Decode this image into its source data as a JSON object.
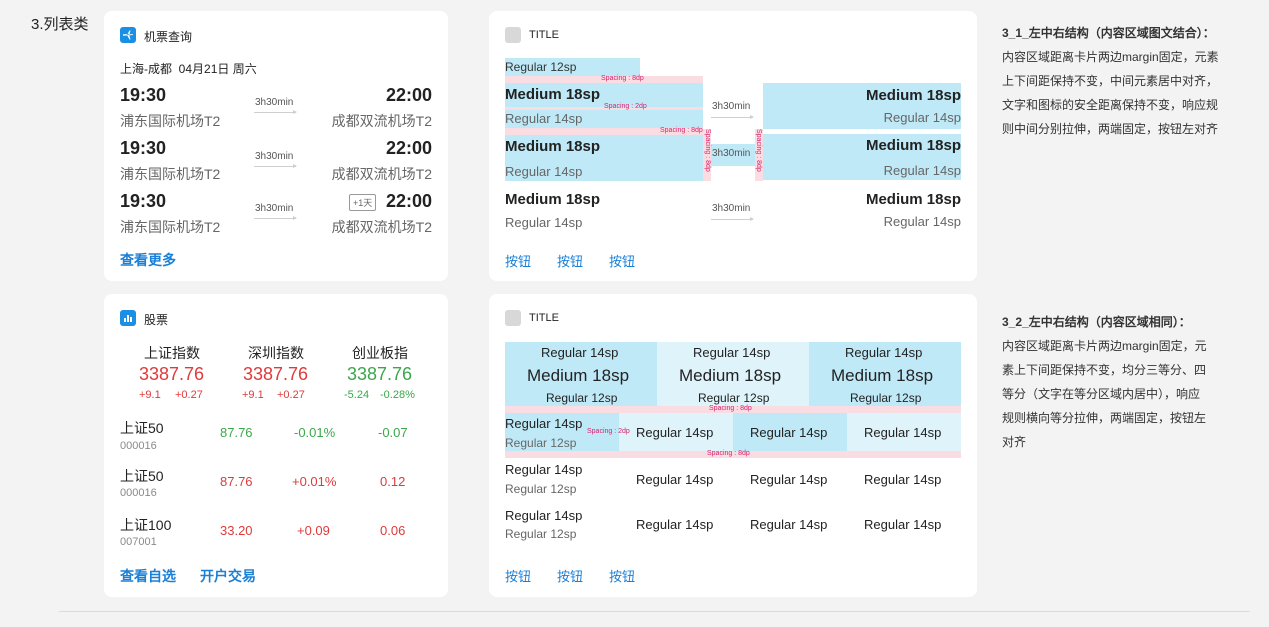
{
  "section_title": "3.列表类",
  "flight": {
    "title": "机票查询",
    "route": "上海-成都",
    "date": "04月21日 周六",
    "rows": [
      {
        "dep": "19:30",
        "dep_airport": "浦东国际机场T2",
        "duration": "3h30min",
        "arr": "22:00",
        "arr_airport": "成都双流机场T2",
        "badge": ""
      },
      {
        "dep": "19:30",
        "dep_airport": "浦东国际机场T2",
        "duration": "3h30min",
        "arr": "22:00",
        "arr_airport": "成都双流机场T2",
        "badge": ""
      },
      {
        "dep": "19:30",
        "dep_airport": "浦东国际机场T2",
        "duration": "3h30min",
        "arr": "22:00",
        "arr_airport": "成都双流机场T2",
        "badge": "+1天"
      }
    ],
    "more_link": "查看更多"
  },
  "spec1": {
    "title": "TITLE",
    "regular12": "Regular 12sp",
    "medium18": "Medium 18sp",
    "regular14": "Regular 14sp",
    "duration": "3h30min",
    "spacing8": "Spacing : 8dp",
    "spacing2": "Spacing : 2dp",
    "buttons": [
      "按钮",
      "按钮",
      "按钮"
    ]
  },
  "note1": {
    "heading": "3_1_左中右结构（内容区域图文结合）：",
    "lines": [
      "内容区域距离卡片两边margin固定，元素",
      "上下间距保持不变，中间元素居中对齐，",
      "文字和图标的安全距离保持不变，响应规",
      "则中间分别拉伸，两端固定，按钮左对齐"
    ]
  },
  "stock": {
    "title": "股票",
    "indices": [
      {
        "name": "上证指数",
        "value": "3387.76",
        "chg": "+9.1",
        "pct": "+0.27",
        "color": "#e03a3a"
      },
      {
        "name": "深圳指数",
        "value": "3387.76",
        "chg": "+9.1",
        "pct": "+0.27",
        "color": "#e03a3a"
      },
      {
        "name": "创业板指",
        "value": "3387.76",
        "chg": "-5.24",
        "pct": "-0.28%",
        "color": "#3aa84a"
      }
    ],
    "rows": [
      {
        "name": "上证50",
        "code": "000016",
        "price": "87.76",
        "pct": "-0.01%",
        "chg": "-0.07",
        "price_color": "#3aa84a",
        "pct_color": "#3aa84a",
        "chg_color": "#3aa84a"
      },
      {
        "name": "上证50",
        "code": "000016",
        "price": "87.76",
        "pct": "+0.01%",
        "chg": "0.12",
        "price_color": "#e03a3a",
        "pct_color": "#e03a3a",
        "chg_color": "#e03a3a"
      },
      {
        "name": "上证100",
        "code": "007001",
        "price": "33.20",
        "pct": "+0.09",
        "chg": "0.06",
        "price_color": "#e03a3a",
        "pct_color": "#e03a3a",
        "chg_color": "#e03a3a"
      }
    ],
    "link1": "查看自选",
    "link2": "开户交易"
  },
  "spec2": {
    "title": "TITLE",
    "regular14": "Regular 14sp",
    "medium18": "Medium 18sp",
    "regular12": "Regular 12sp",
    "spacing8": "Spacing : 8dp",
    "spacing2": "Spacing : 2dp",
    "buttons": [
      "按钮",
      "按钮",
      "按钮"
    ]
  },
  "note2": {
    "heading": "3_2_左中右结构（内容区域相同）：",
    "lines": [
      "内容区域距离卡片两边margin固定，元",
      "素上下间距保持不变，均分三等分、四",
      "等分（文字在等分区域内居中），响应",
      "规则横向等分拉伸，两端固定，按钮左",
      "对齐"
    ]
  }
}
